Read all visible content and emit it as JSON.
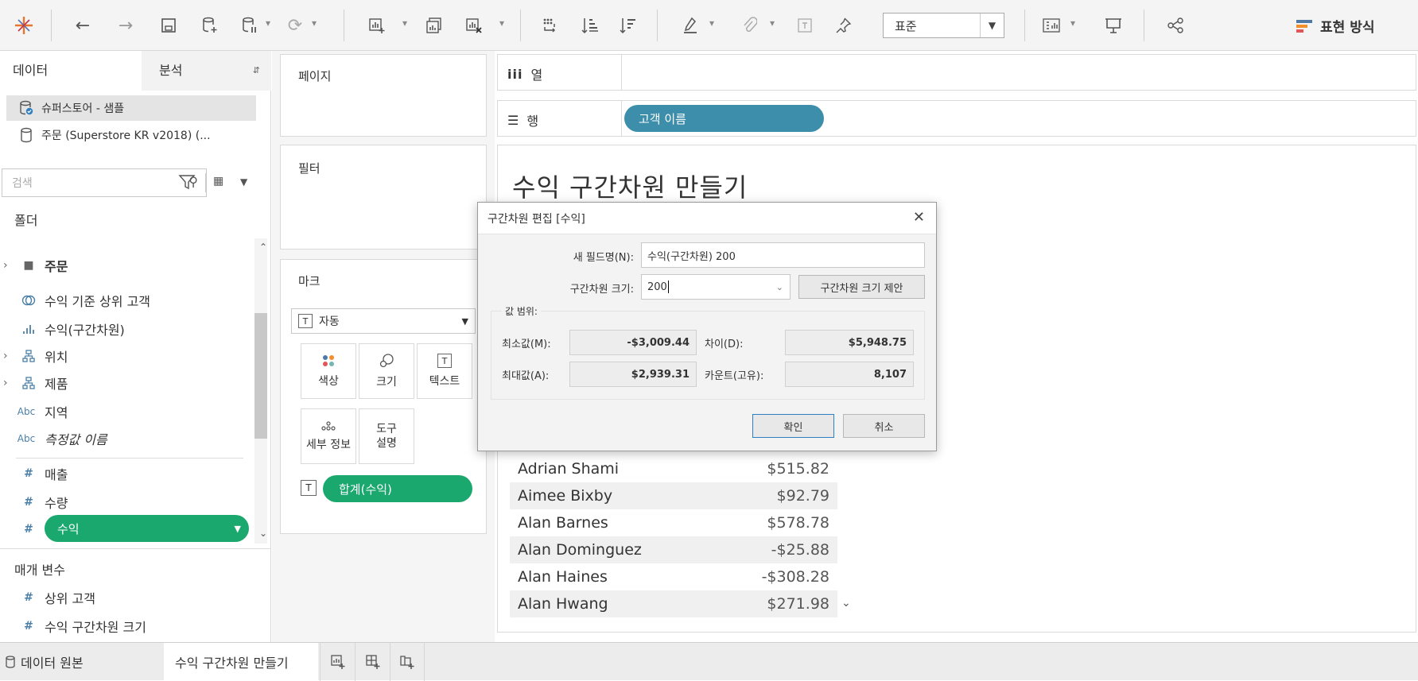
{
  "toolbar": {
    "standard_select": "표준",
    "show_me": "표현 방식"
  },
  "left_panel": {
    "tab_data": "데이터",
    "tab_analysis": "분석",
    "datasources": [
      "슈퍼스토어 - 샘플",
      "주문 (Superstore KR v2018) (..."
    ],
    "search_placeholder": "검색",
    "folder_header": "폴더",
    "fields": [
      {
        "icon": "folder-icon",
        "label": "주문",
        "bold": true
      },
      {
        "icon": "set-icon",
        "label": "수익 기준 상위 고객"
      },
      {
        "icon": "bin-icon",
        "label": "수익(구간차원)"
      },
      {
        "icon": "hierarchy-icon",
        "label": "위치"
      },
      {
        "icon": "hierarchy-icon",
        "label": "제품"
      },
      {
        "icon": "abc-icon",
        "label": "지역",
        "abc": "Abc"
      },
      {
        "icon": "abc-icon",
        "label": "측정값 이름",
        "abc": "Abc",
        "italic": true
      },
      {
        "icon": "measure-icon",
        "label": "매출"
      },
      {
        "icon": "measure-icon",
        "label": "수량"
      },
      {
        "icon": "measure-icon",
        "label": "수익",
        "selected": true
      }
    ],
    "params_header": "매개 변수",
    "params": [
      "상위 고객",
      "수익 구간차원 크기"
    ]
  },
  "shelves": {
    "pages": "페이지",
    "filters": "필터",
    "marks": "마크",
    "mark_type": "자동",
    "mark_buttons": [
      "색상",
      "크기",
      "텍스트",
      "세부 정보",
      "도구\n설명"
    ],
    "sum_pill": "합계(수익)",
    "columns": "열",
    "rows": "행",
    "rows_pill": "고객 이름"
  },
  "canvas": {
    "title": "수익 구간차원 만들기",
    "rows": [
      {
        "name": "Adrian Shami",
        "value": "$515.82"
      },
      {
        "name": "Aimee Bixby",
        "value": "$92.79"
      },
      {
        "name": "Alan Barnes",
        "value": "$578.78"
      },
      {
        "name": "Alan Dominguez",
        "value": "-$25.88"
      },
      {
        "name": "Alan Haines",
        "value": "-$308.28"
      },
      {
        "name": "Alan Hwang",
        "value": "$271.98"
      }
    ]
  },
  "dialog": {
    "title": "구간차원 편집 [수익]",
    "new_field_label": "새 필드명(N):",
    "new_field_value": "수익(구간차원) 200",
    "bin_size_label": "구간차원 크기:",
    "bin_size_value": "200",
    "suggest_button": "구간차원 크기 제안",
    "range_header": "값 범위:",
    "min_label": "최소값(M):",
    "min_value": "-$3,009.44",
    "diff_label": "차이(D):",
    "diff_value": "$5,948.75",
    "max_label": "최대값(A):",
    "max_value": "$2,939.31",
    "count_label": "카운트(고유):",
    "count_value": "8,107",
    "ok": "확인",
    "cancel": "취소"
  },
  "bottom_tabs": {
    "datasource": "데이터 원본",
    "sheet": "수익 구간차원 만들기"
  }
}
